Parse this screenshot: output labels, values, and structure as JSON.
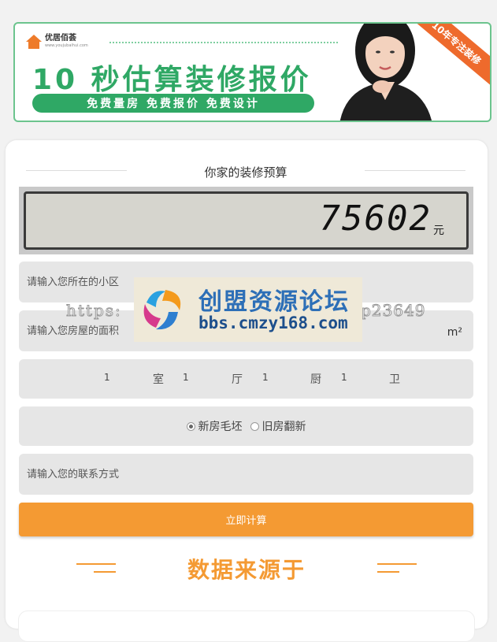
{
  "banner": {
    "brand_name": "优居佰荟",
    "brand_url": "www.youjubaihui.com",
    "title": "10 秒估算装修报价",
    "pill_text": "免费量房  免费报价  免费设计",
    "ribbon_text": "10年专注装修"
  },
  "calculator": {
    "heading": "你家的装修预算",
    "amount": "75602",
    "unit": "元",
    "community_placeholder": "请输入您所在的小区",
    "area_placeholder": "请输入您房屋的面积",
    "area_unit": "m²",
    "rooms": [
      {
        "count": "1",
        "label": "室"
      },
      {
        "count": "1",
        "label": "厅"
      },
      {
        "count": "1",
        "label": "厨"
      },
      {
        "count": "1",
        "label": "卫"
      }
    ],
    "house_type": {
      "options": [
        "新房毛坯",
        "旧房翻新"
      ],
      "selected": "新房毛坯"
    },
    "contact_placeholder": "请输入您的联系方式",
    "submit_label": "立即计算"
  },
  "source_section": {
    "title": "数据来源于"
  },
  "watermark": {
    "cn": "创盟资源论坛",
    "url": "bbs.cmzy168.com",
    "left_text": "https:",
    "right_text": "p23649"
  },
  "colors": {
    "green": "#2fa865",
    "orange": "#f49a33",
    "field_bg": "#e6e6e6"
  }
}
